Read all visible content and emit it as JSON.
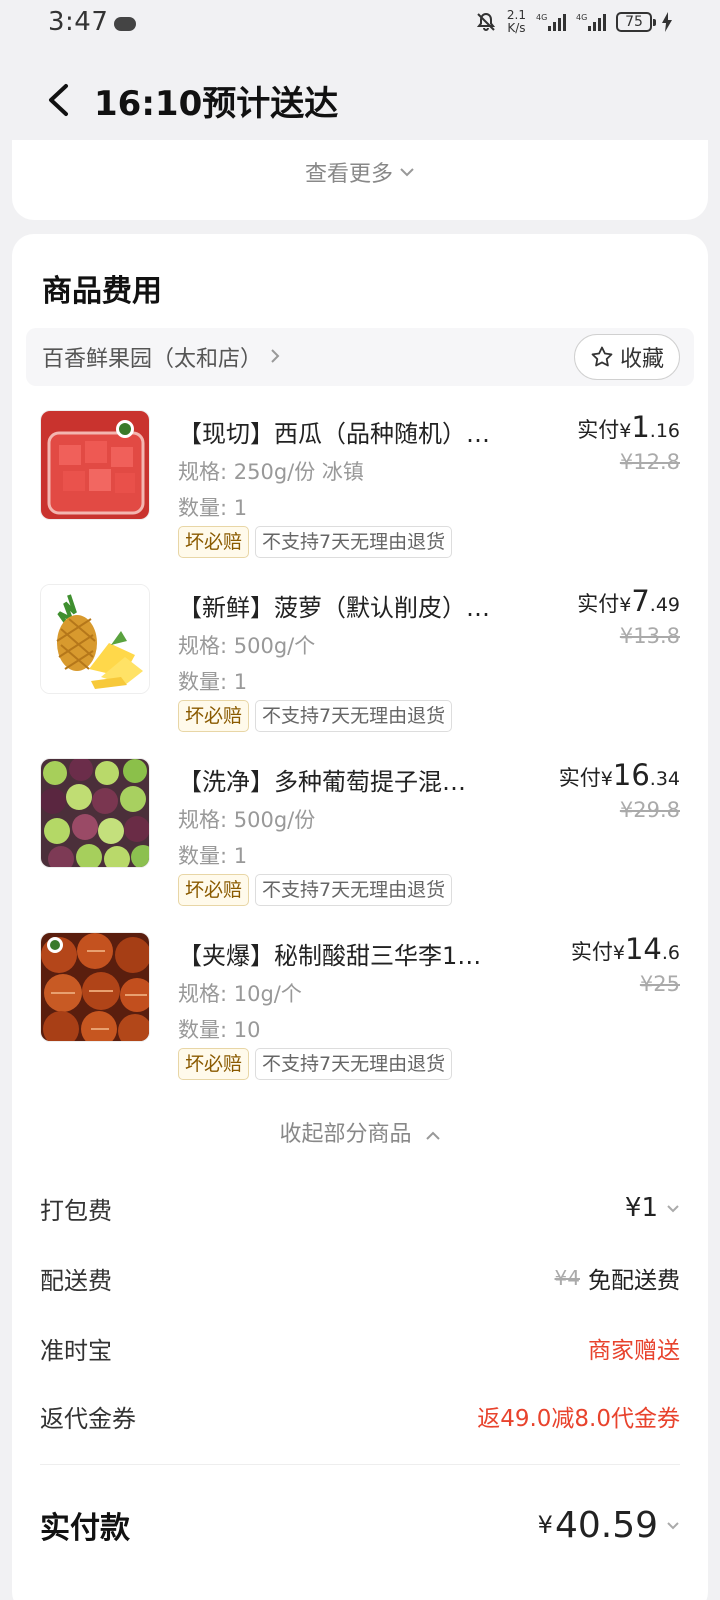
{
  "status": {
    "time": "3:47",
    "speed_top": "2.1",
    "speed_bottom": "K/s",
    "battery": "75"
  },
  "nav": {
    "title": "16:10预计送达"
  },
  "top_card": {
    "see_more": "查看更多"
  },
  "section": {
    "title": "商品费用"
  },
  "store": {
    "name": "百香鲜果园（太和店）",
    "fav_label": "收藏"
  },
  "labels": {
    "paid_prefix": "实付",
    "yen": "¥",
    "tag_guarantee": "坏必赔",
    "tag_noreturn": "不支持7天无理由退货"
  },
  "products": [
    {
      "name": "【现切】西瓜（品种随机）…",
      "spec": "规格: 250g/份 冰镇",
      "qty": "数量: 1",
      "paid_int": "1",
      "paid_dec": ".16",
      "orig": "¥12.8"
    },
    {
      "name": "【新鲜】菠萝（默认削皮）…",
      "spec": "规格: 500g/个",
      "qty": "数量: 1",
      "paid_int": "7",
      "paid_dec": ".49",
      "orig": "¥13.8"
    },
    {
      "name": "【洗净】多种葡萄提子混…",
      "spec": "规格: 500g/份",
      "qty": "数量: 1",
      "paid_int": "16",
      "paid_dec": ".34",
      "orig": "¥29.8"
    },
    {
      "name": "【夹爆】秘制酸甜三华李1…",
      "spec": "规格: 10g/个",
      "qty": "数量: 10",
      "paid_int": "14",
      "paid_dec": ".6",
      "orig": "¥25"
    }
  ],
  "collapse_label": "收起部分商品",
  "fees": {
    "packing": {
      "label": "打包费",
      "value": "¥1"
    },
    "delivery": {
      "label": "配送费",
      "orig": "¥4",
      "value": "免配送费"
    },
    "ontime": {
      "label": "准时宝",
      "value": "商家赠送"
    },
    "coupon": {
      "label": "返代金券",
      "value": "返49.0减8.0代金券"
    }
  },
  "total": {
    "label": "实付款",
    "yen": "¥",
    "value": "40.59"
  },
  "colors": {
    "accent_red": "#e8432d",
    "background": "#f1f1f3",
    "card": "#ffffff"
  }
}
